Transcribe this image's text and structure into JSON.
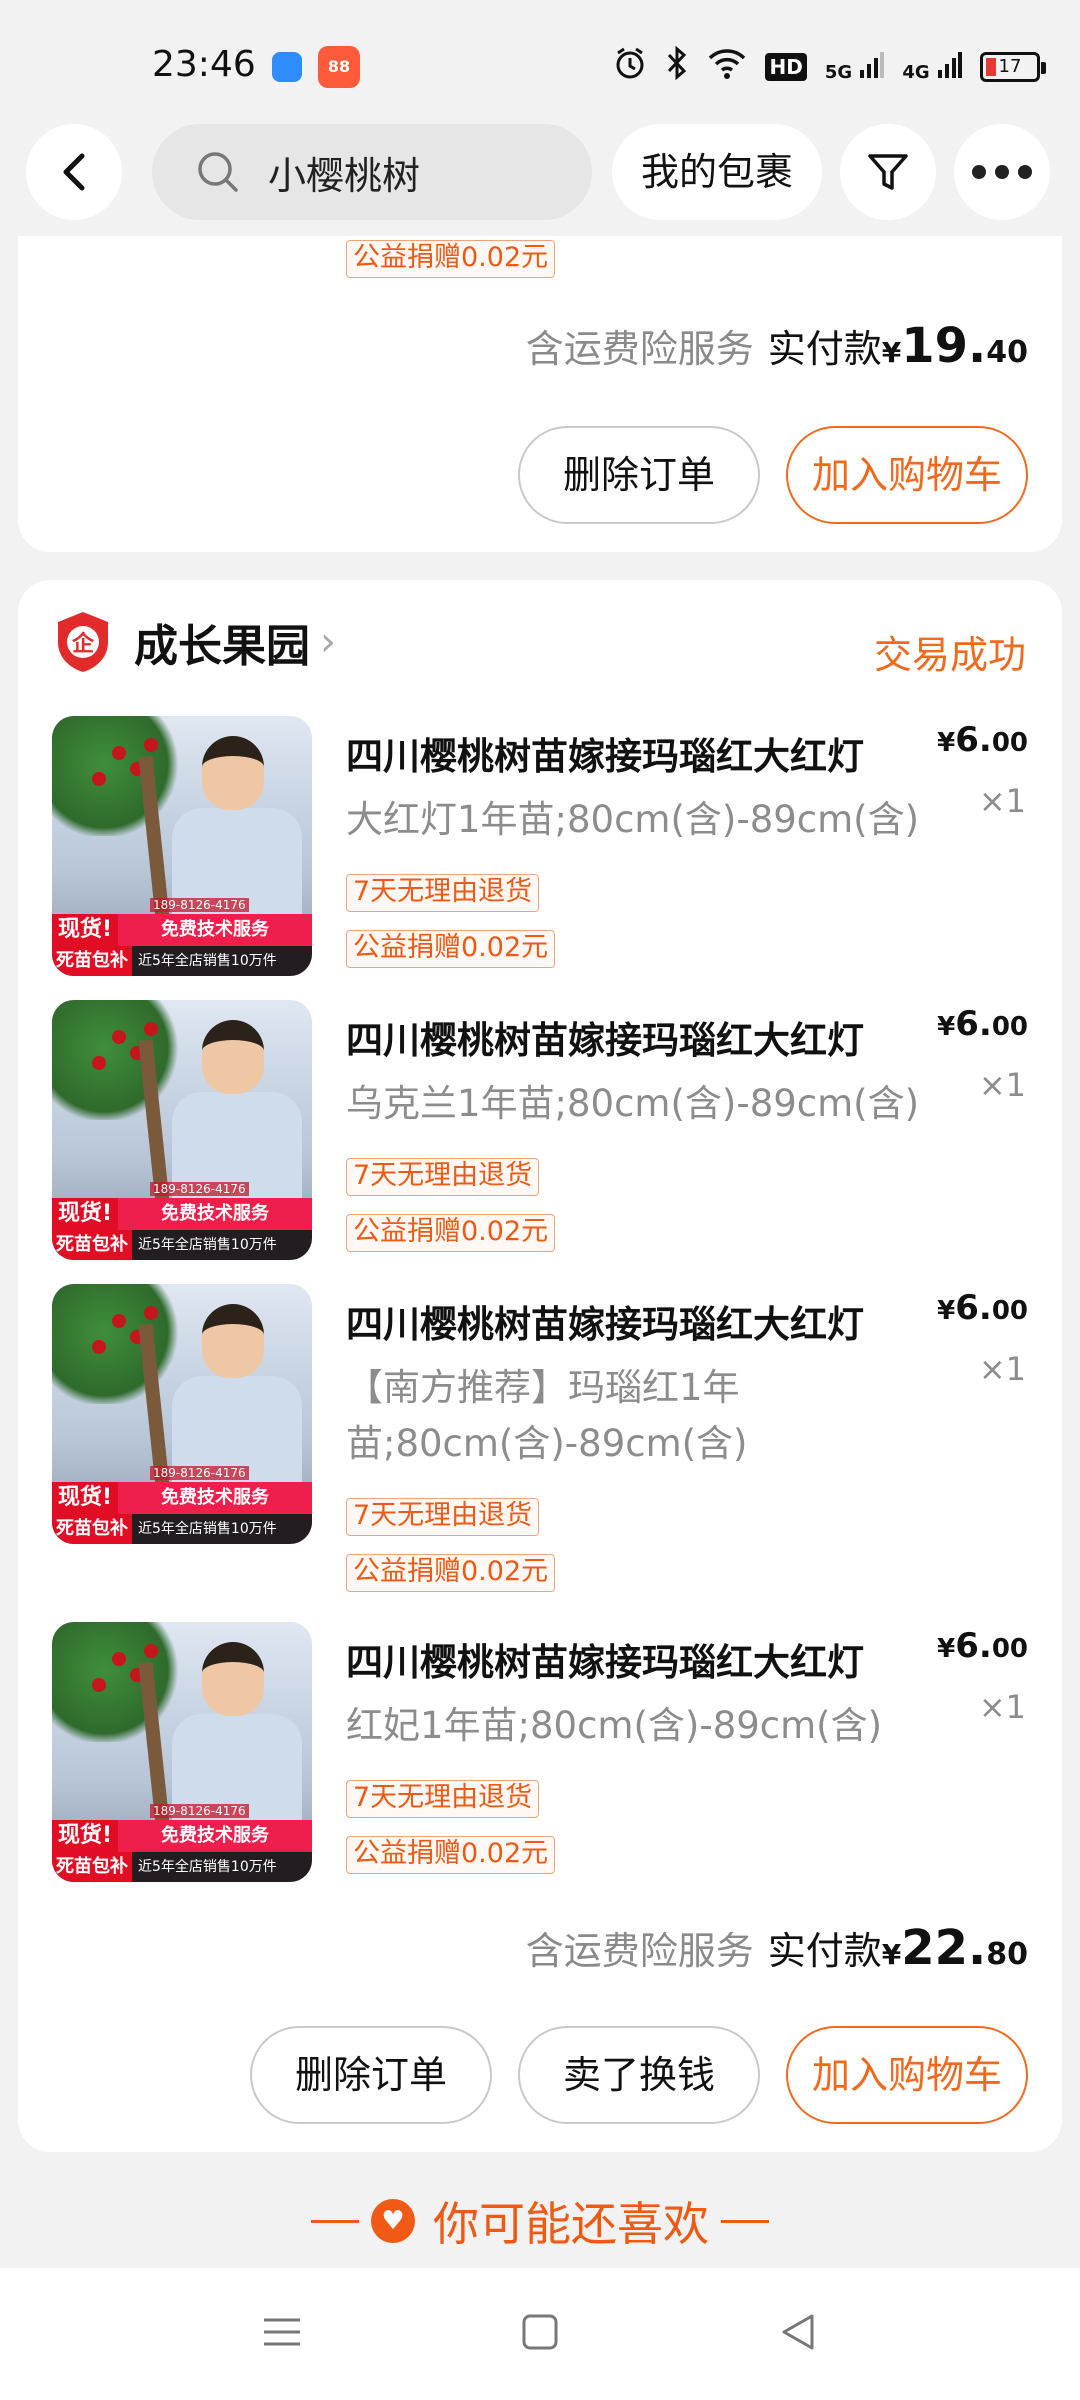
{
  "status_bar": {
    "time": "23:46",
    "app_badge_2_text": "88",
    "icons": [
      "alarm-icon",
      "bluetooth-icon",
      "wifi-icon",
      "hd-icon",
      "signal-5g-icon",
      "signal-4g-icon"
    ],
    "hd_label": "HD",
    "net1": "5G",
    "net2": "4G",
    "battery": "17"
  },
  "top_nav": {
    "search_text": "小樱桃树",
    "parcel_label": "我的包裹"
  },
  "order1": {
    "donate_tag": "公益捐赠0.02元",
    "total_note": "含运费险服务",
    "total_label": "实付款",
    "total_yen": "¥",
    "total_int": "19.",
    "total_dec": "40",
    "btn_delete": "删除订单",
    "btn_cart": "加入购物车"
  },
  "order2": {
    "shop_name": "成长果园",
    "shop_chevron": "›",
    "status": "交易成功",
    "items": [
      {
        "title": "四川樱桃树苗嫁接玛瑙红大红灯",
        "sku": "大红灯1年苗;80cm(含)-89cm(含)",
        "price_yen": "¥",
        "price_int": "6.",
        "price_dec": "00",
        "qty": "×1",
        "return_tag": "7天无理由退货",
        "donate_tag": "公益捐赠0.02元"
      },
      {
        "title": "四川樱桃树苗嫁接玛瑙红大红灯",
        "sku": "乌克兰1年苗;80cm(含)-89cm(含)",
        "price_yen": "¥",
        "price_int": "6.",
        "price_dec": "00",
        "qty": "×1",
        "return_tag": "7天无理由退货",
        "donate_tag": "公益捐赠0.02元"
      },
      {
        "title": "四川樱桃树苗嫁接玛瑙红大红灯",
        "sku": "【南方推荐】玛瑙红1年苗;80cm(含)-89cm(含)",
        "price_yen": "¥",
        "price_int": "6.",
        "price_dec": "00",
        "qty": "×1",
        "return_tag": "7天无理由退货",
        "donate_tag": "公益捐赠0.02元"
      },
      {
        "title": "四川樱桃树苗嫁接玛瑙红大红灯",
        "sku": "红妃1年苗;80cm(含)-89cm(含)",
        "price_yen": "¥",
        "price_int": "6.",
        "price_dec": "00",
        "qty": "×1",
        "return_tag": "7天无理由退货",
        "donate_tag": "公益捐赠0.02元"
      }
    ],
    "thumb_text": {
      "badge1": "现货!",
      "badge2": "免费技术服务",
      "badge3": "死苗包补",
      "badge4": "近5年全店销售10万件",
      "phone": "189-8126-4176"
    },
    "total_note": "含运费险服务",
    "total_label": "实付款",
    "total_yen": "¥",
    "total_int": "22.",
    "total_dec": "80",
    "btn_delete": "删除订单",
    "btn_sell": "卖了换钱",
    "btn_cart": "加入购物车"
  },
  "recommend": {
    "label": "你可能还喜欢"
  },
  "colors": {
    "accent": "#f06a1e",
    "background": "#f2f2f2",
    "card": "#ffffff",
    "muted_text": "#8c8c8c"
  }
}
